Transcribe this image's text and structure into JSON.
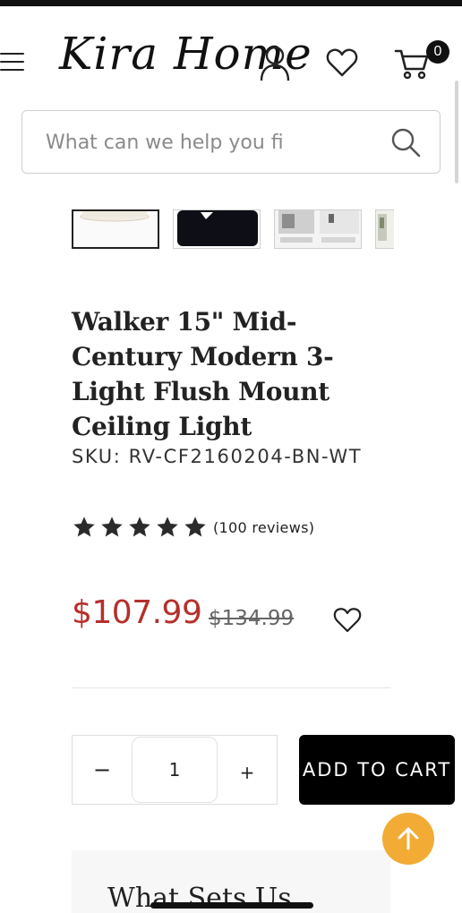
{
  "header": {
    "logo_text": "Kira Home",
    "cart_count": "0",
    "icons": {
      "menu": "hamburger-menu-icon",
      "account": "user-icon",
      "wishlist": "heart-icon",
      "cart": "cart-icon"
    }
  },
  "search": {
    "placeholder": "What can we help you fi",
    "icon": "search-icon"
  },
  "gallery": {
    "thumbnails": [
      {
        "name": "flush-mount-light-thumbnail",
        "active": true
      },
      {
        "name": "video-thumbnail",
        "icon": "play-icon"
      },
      {
        "name": "lifestyle-thumbnail"
      },
      {
        "name": "room-thumbnail"
      }
    ]
  },
  "product": {
    "title": "Walker 15\" Mid-Century Modern 3-Light Flush Mount Ceiling Light",
    "sku": "SKU: RV-CF2160204-BN-WT",
    "rating": 5,
    "reviews": "(100 reviews)",
    "price": "$107.99",
    "compare_price": "$134.99",
    "price_color": "#b5302b"
  },
  "cart_form": {
    "minus_label": "−",
    "quantity": "1",
    "plus_label": "+",
    "add_to_cart_label": "ADD TO CART"
  },
  "section": {
    "heading": "What Sets Us"
  },
  "colors": {
    "accent_button": "#000000",
    "back_to_top": "#f2ab34"
  }
}
